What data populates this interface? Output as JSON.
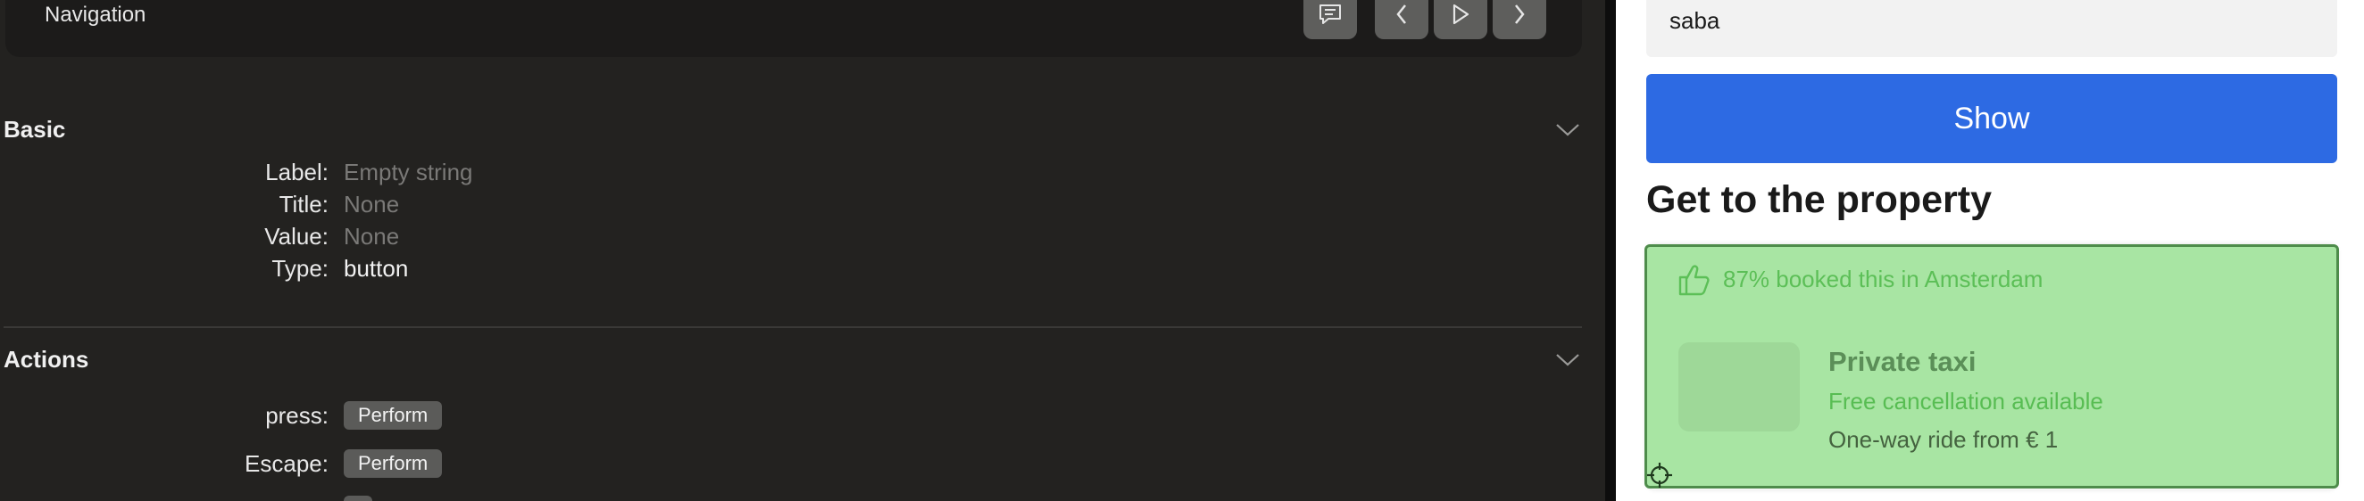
{
  "inspector": {
    "navigation_title": "Navigation",
    "basic": {
      "title": "Basic",
      "rows": [
        {
          "key": "Label:",
          "value": "Empty string"
        },
        {
          "key": "Title:",
          "value": "None"
        },
        {
          "key": "Value:",
          "value": "None"
        },
        {
          "key": "Type:",
          "value": "button"
        }
      ]
    },
    "actions": {
      "title": "Actions",
      "rows": [
        {
          "key": "press:",
          "button": "Perform"
        },
        {
          "key": "Escape:",
          "button": "Perform"
        }
      ]
    },
    "colors": {
      "panel": "#232220",
      "nav_box": "#1c1b1a",
      "button": "#5b5b59"
    }
  },
  "preview": {
    "name_value": "saba",
    "show_label": "Show",
    "heading": "Get to the property",
    "card": {
      "booked": "87% booked this in Amsterdam",
      "title": "Private taxi",
      "cancellation": "Free cancellation available",
      "ride": "One-way ride from € 1"
    },
    "colors": {
      "show_button": "#2d6ae3",
      "highlight": "#a8e5a3",
      "highlight_border": "#4e8c4b"
    }
  }
}
